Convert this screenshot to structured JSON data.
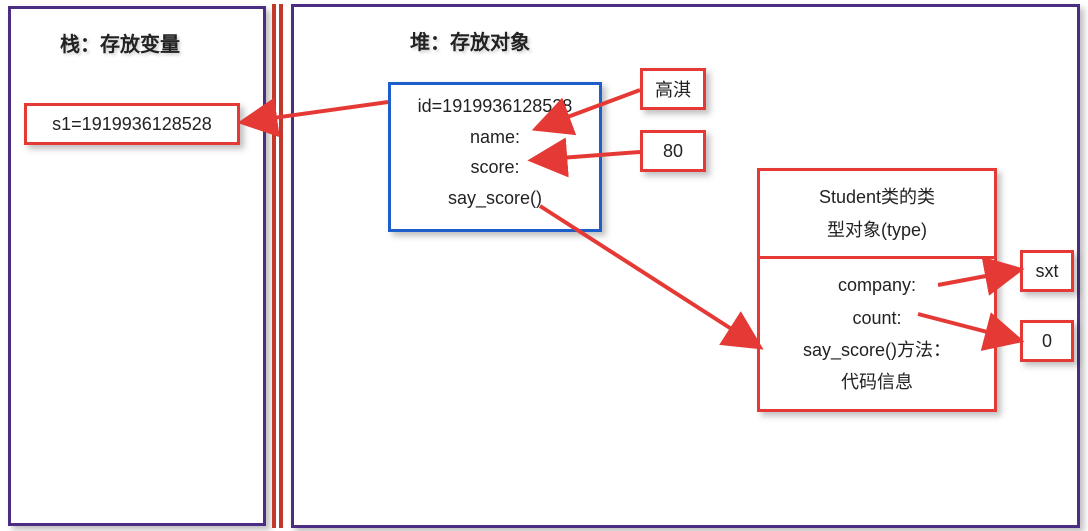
{
  "stack": {
    "title": "栈：存放变量",
    "s1": "s1=1919936128528"
  },
  "heap": {
    "title": "堆：存放对象",
    "instance": {
      "id_line": "id=1919936128528",
      "name_label": "name:",
      "score_label": "score:",
      "say_score_label": "say_score()"
    },
    "name_value": "高淇",
    "score_value": "80",
    "class_box": {
      "header1": "Student类的类",
      "header2": "型对象(type)",
      "company_label": "company:",
      "count_label": "count:",
      "say_score_method": "say_score()方法：",
      "code_info": "代码信息"
    },
    "company_value": "sxt",
    "count_value": "0"
  }
}
